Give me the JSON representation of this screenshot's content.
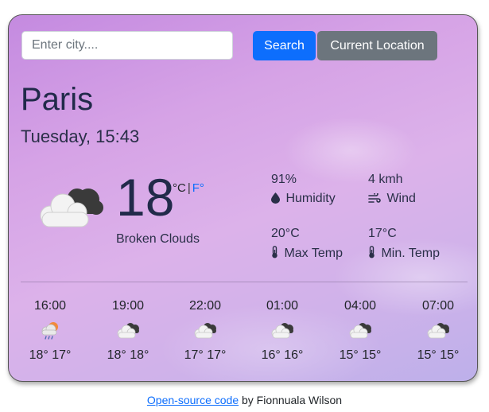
{
  "search": {
    "placeholder": "Enter city....",
    "value": ""
  },
  "buttons": {
    "search_label": "Search",
    "location_label": "Current Location"
  },
  "current": {
    "city": "Paris",
    "datetime": "Tuesday, 15:43",
    "temperature": "18",
    "unit_c": "°C",
    "unit_sep": "|",
    "unit_f": "F°",
    "description": "Broken Clouds",
    "icon": "broken-clouds-icon"
  },
  "stats": {
    "humidity": {
      "value": "91%",
      "label": "Humidity",
      "icon": "droplet-icon"
    },
    "wind": {
      "value": "4 kmh",
      "label": "Wind",
      "icon": "wind-icon"
    },
    "max_temp": {
      "value": "20°C",
      "label": "Max Temp",
      "icon": "thermometer-icon"
    },
    "min_temp": {
      "value": "17°C",
      "label": "Min. Temp",
      "icon": "thermometer-icon"
    }
  },
  "forecast": [
    {
      "time": "16:00",
      "temps": "18° 17°",
      "icon": "rain-cloud-icon"
    },
    {
      "time": "19:00",
      "temps": "18° 18°",
      "icon": "broken-clouds-icon"
    },
    {
      "time": "22:00",
      "temps": "17° 17°",
      "icon": "broken-clouds-icon"
    },
    {
      "time": "01:00",
      "temps": "16° 16°",
      "icon": "broken-clouds-icon"
    },
    {
      "time": "04:00",
      "temps": "15° 15°",
      "icon": "broken-clouds-icon"
    },
    {
      "time": "07:00",
      "temps": "15° 15°",
      "icon": "broken-clouds-icon"
    }
  ],
  "footer": {
    "link_text": "Open-source code",
    "suffix": " by Fionnuala Wilson"
  },
  "colors": {
    "primary": "#0d6efd",
    "secondary": "#6c757d"
  }
}
